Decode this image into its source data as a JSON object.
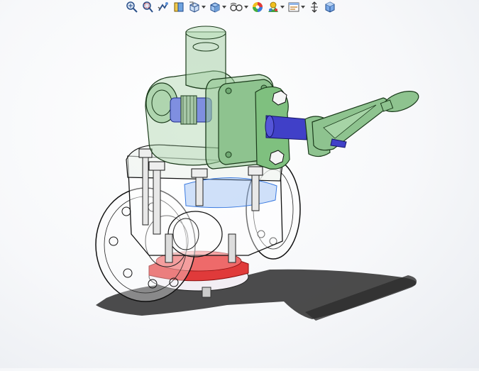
{
  "toolbar": {
    "items": [
      {
        "name": "zoom-to-fit-icon",
        "dropdown": false
      },
      {
        "name": "zoom-to-area-icon",
        "dropdown": false
      },
      {
        "name": "previous-view-icon",
        "dropdown": false
      },
      {
        "name": "section-view-icon",
        "dropdown": false
      },
      {
        "name": "view-orientation-icon",
        "dropdown": true
      },
      {
        "name": "display-style-icon",
        "dropdown": true
      },
      {
        "name": "hide-show-items-icon",
        "dropdown": true
      },
      {
        "name": "edit-appearance-icon",
        "dropdown": false
      },
      {
        "name": "apply-scene-icon",
        "dropdown": true
      },
      {
        "name": "view-settings-icon",
        "dropdown": true
      },
      {
        "name": "rotate-view-icon",
        "dropdown": false
      },
      {
        "name": "3d-view-cube-icon",
        "dropdown": false
      }
    ]
  },
  "colors": {
    "green_part": "#86c08a",
    "green_dark": "#3e7a44",
    "blue_shaft": "#4040c8",
    "red_seat": "#e03a3a",
    "outline": "#1a1a1a",
    "shadow": "#2a2a2a"
  },
  "model": {
    "name": "valve-assembly"
  }
}
